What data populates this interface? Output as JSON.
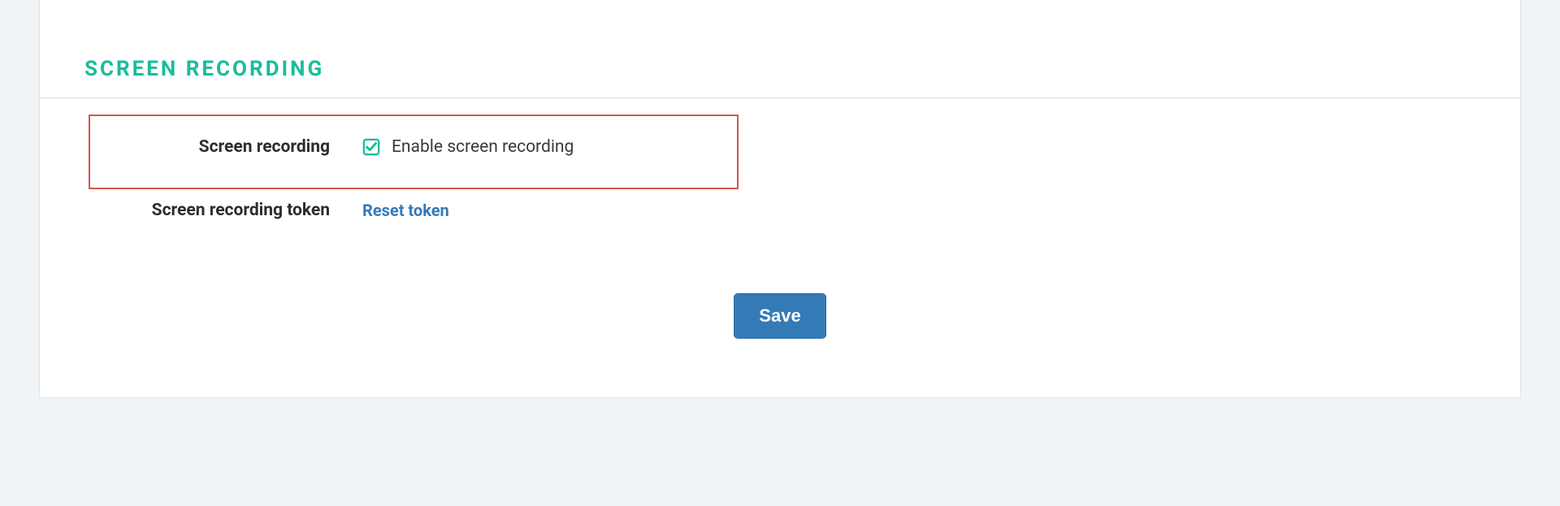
{
  "section": {
    "title": "SCREEN  RECORDING"
  },
  "fields": {
    "recording": {
      "label": "Screen recording",
      "checkbox_label": "Enable screen recording",
      "checked": true
    },
    "token": {
      "label": "Screen recording token",
      "reset_link": "Reset token"
    }
  },
  "buttons": {
    "save": "Save"
  }
}
